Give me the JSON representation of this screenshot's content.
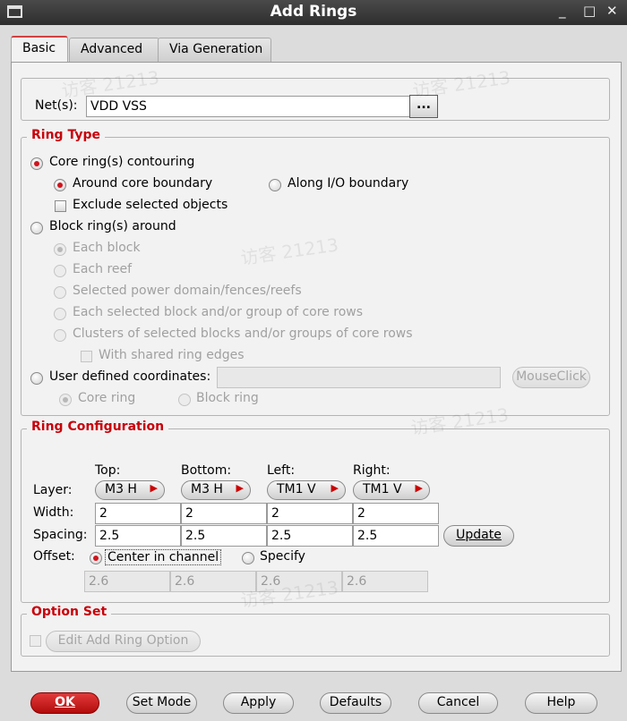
{
  "window": {
    "title": "Add Rings",
    "minimize": "_",
    "maximize": "□",
    "close": "✕"
  },
  "tabs": [
    {
      "label": "Basic"
    },
    {
      "label": "Advanced"
    },
    {
      "label": "Via Generation"
    }
  ],
  "nets": {
    "label": "Net(s):",
    "value": "VDD VSS",
    "browse": "..."
  },
  "ring_type": {
    "legend": "Ring Type",
    "core_ring": "Core ring(s) contouring",
    "around_core": "Around core boundary",
    "along_io": "Along I/O boundary",
    "exclude_selected": "Exclude selected objects",
    "block_ring": "Block ring(s) around",
    "each_block": "Each block",
    "each_reef": "Each reef",
    "selected_power_domain": "Selected power domain/fences/reefs",
    "each_selected_block": "Each selected block and/or group of core rows",
    "clusters": "Clusters of selected blocks and/or groups of core rows",
    "shared_edges": "With shared ring edges",
    "user_defined": "User defined coordinates:",
    "user_defined_value": "",
    "mouse_click": "MouseClick",
    "core_ring_opt": "Core ring",
    "block_ring_opt": "Block ring"
  },
  "ring_config": {
    "legend": "Ring Configuration",
    "col_headers": [
      "Top:",
      "Bottom:",
      "Left:",
      "Right:"
    ],
    "layer_label": "Layer:",
    "layers": [
      "M3 H",
      "M3 H",
      "TM1 V",
      "TM1 V"
    ],
    "width_label": "Width:",
    "widths": [
      "2",
      "2",
      "2",
      "2"
    ],
    "spacing_label": "Spacing:",
    "spacings": [
      "2.5",
      "2.5",
      "2.5",
      "2.5"
    ],
    "update": "Update",
    "offset_label": "Offset:",
    "center_in_channel": "Center in channel",
    "specify": "Specify",
    "offsets": [
      "2.6",
      "2.6",
      "2.6",
      "2.6"
    ]
  },
  "option_set": {
    "legend": "Option Set",
    "edit_button": "Edit Add Ring Option"
  },
  "buttons": {
    "ok": "OK",
    "set_mode": "Set Mode",
    "apply": "Apply",
    "defaults": "Defaults",
    "cancel": "Cancel",
    "help": "Help"
  },
  "watermark": "访客 21213",
  "colors": {
    "accent": "#c8000a",
    "titlebar": "#3a3a3a",
    "panel": "#f2f2f2"
  }
}
